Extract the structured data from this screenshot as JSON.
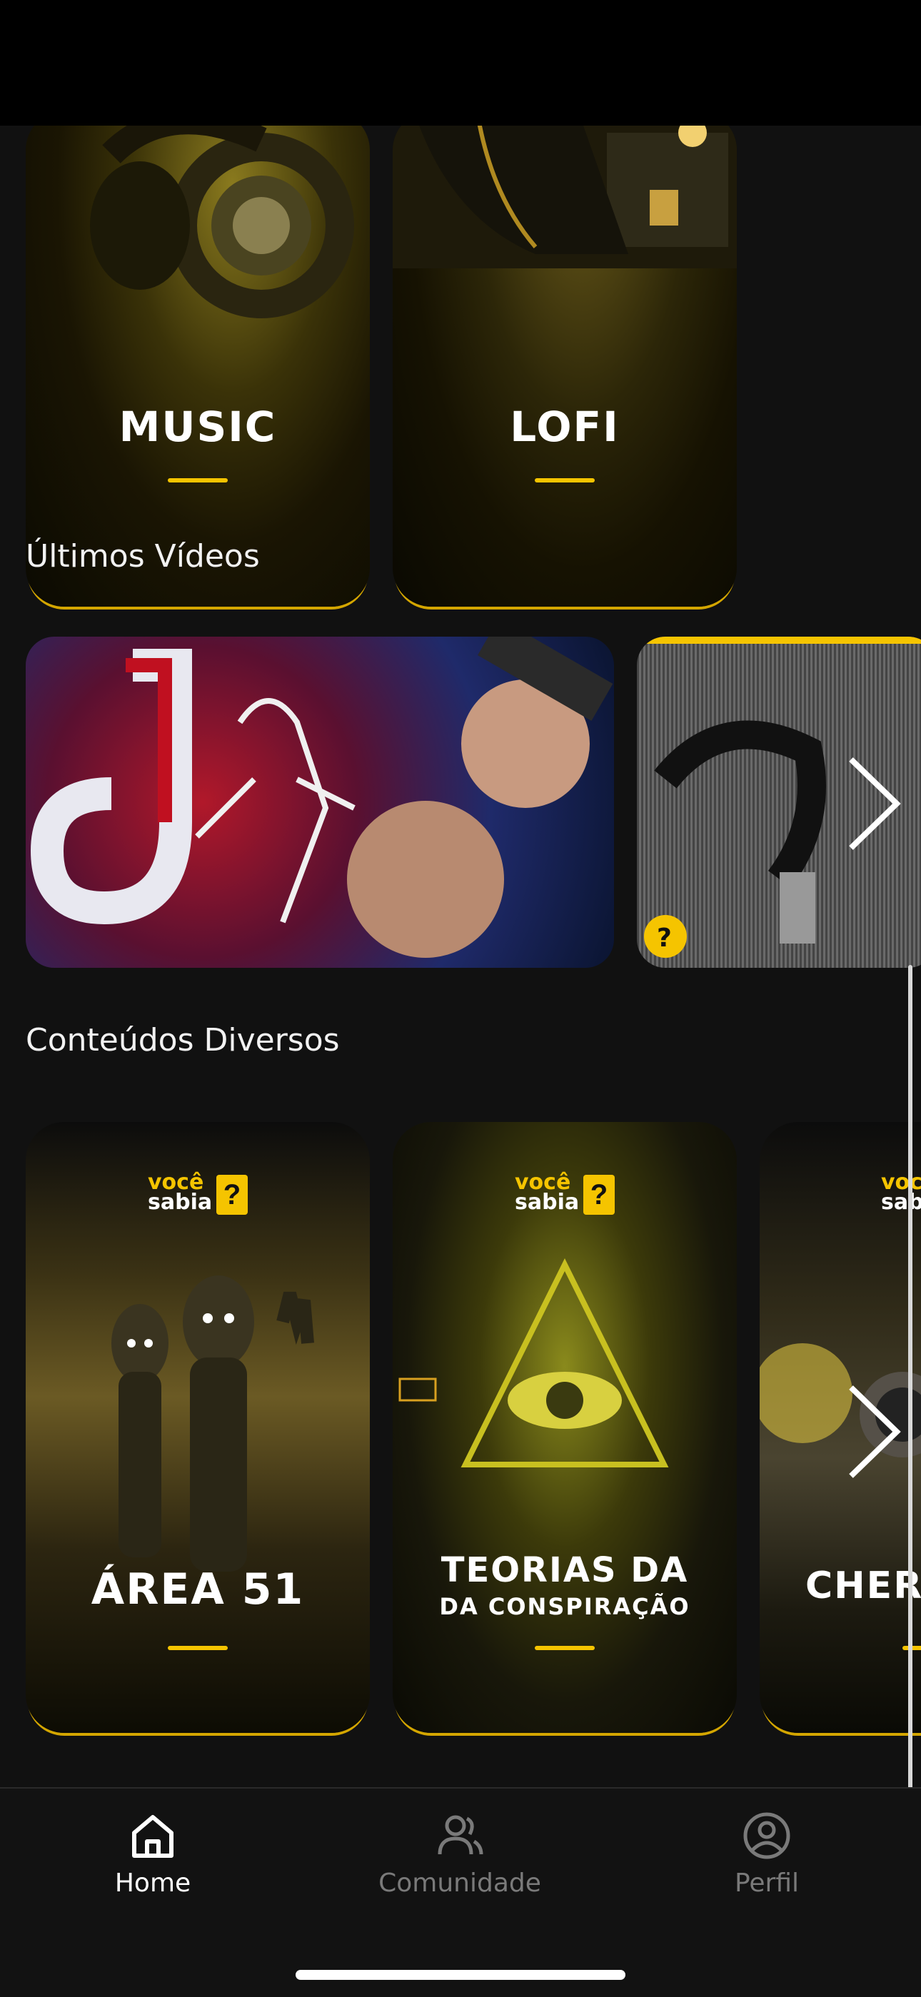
{
  "categories": [
    {
      "label": "MUSIC"
    },
    {
      "label": "LOFI"
    }
  ],
  "sections": {
    "latest_videos": {
      "title": "Últimos Vídeos"
    },
    "misc_content": {
      "title": "Conteúdos Diversos"
    }
  },
  "content_cards": [
    {
      "title": "ÁREA 51",
      "subtitle": "",
      "brand_top": "você",
      "brand_bottom": "sabia",
      "brand_mark": "?"
    },
    {
      "title": "TEORIAS DA",
      "subtitle": "DA CONSPIRAÇÃO",
      "brand_top": "você",
      "brand_bottom": "sabia",
      "brand_mark": "?"
    },
    {
      "title": "CHERI",
      "subtitle": "",
      "brand_top": "voc",
      "brand_bottom": "sab",
      "brand_mark": ""
    }
  ],
  "nav": {
    "items": [
      {
        "label": "Home",
        "icon": "home-icon",
        "active": true
      },
      {
        "label": "Comunidade",
        "icon": "community-icon",
        "active": false
      },
      {
        "label": "Perfil",
        "icon": "profile-icon",
        "active": false
      }
    ]
  },
  "colors": {
    "accent": "#f5c400",
    "background": "#111111",
    "inactive": "#7a7a7a"
  }
}
